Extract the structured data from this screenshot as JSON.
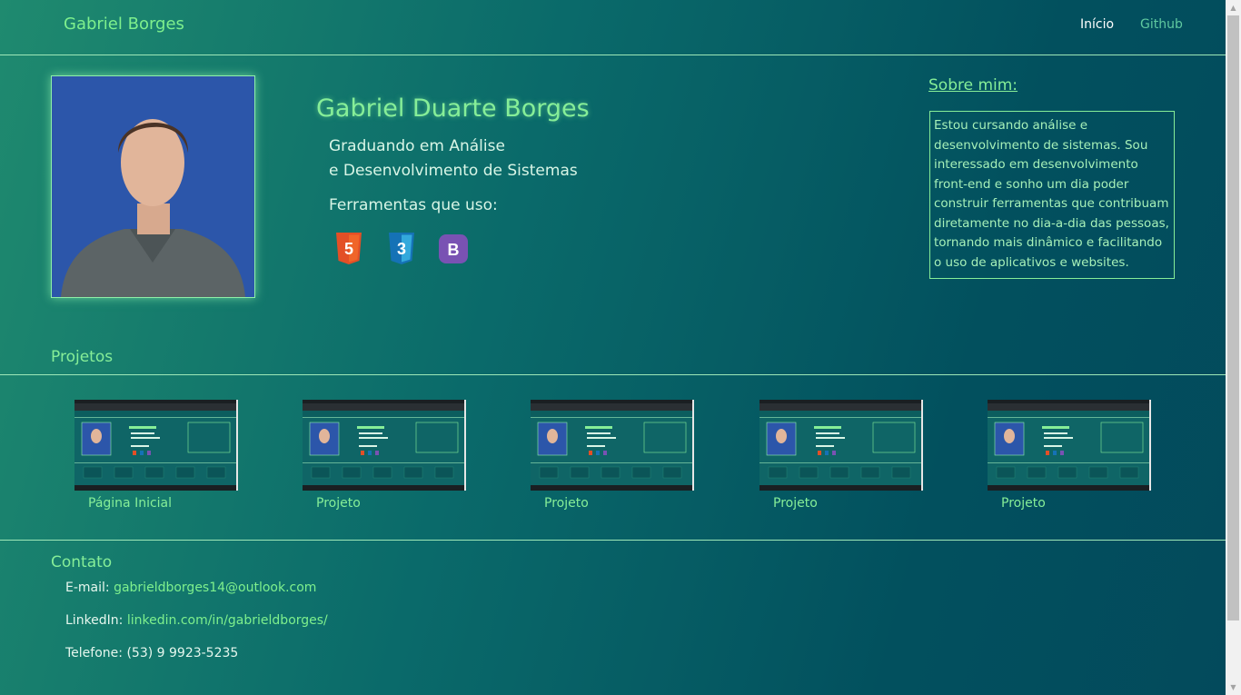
{
  "nav": {
    "brand": "Gabriel Borges",
    "home": "Início",
    "github": "Github"
  },
  "hero": {
    "name": "Gabriel Duarte Borges",
    "role_line1": "Graduando em Análise",
    "role_line2": "e Desenvolvimento de Sistemas",
    "tools_title": "Ferramentas que uso:",
    "tools": [
      {
        "icon": "html5-icon",
        "label": "5",
        "color": "#e34f26"
      },
      {
        "icon": "css3-icon",
        "label": "3",
        "color": "#1572b6"
      },
      {
        "icon": "bootstrap-icon",
        "label": "B",
        "color": "#7952b3"
      }
    ]
  },
  "about": {
    "title": "Sobre mim:",
    "text": "Estou cursando análise e desenvolvimento de sistemas. Sou interessado em desenvolvimento front-end e sonho um dia poder construir ferramentas que contribuam diretamente no dia-a-dia das pessoas, tornando mais dinâmico e facilitando o uso de aplicativos e websites."
  },
  "projects": {
    "title": "Projetos",
    "items": [
      {
        "label": "Página Inicial"
      },
      {
        "label": "Projeto"
      },
      {
        "label": "Projeto"
      },
      {
        "label": "Projeto"
      },
      {
        "label": "Projeto"
      }
    ]
  },
  "contact": {
    "title": "Contato",
    "email_label": "E-mail:",
    "email_value": "gabrieldborges14@outlook.com",
    "linkedin_label": "LinkedIn:",
    "linkedin_value": "linkedin.com/in/gabrieldborges/",
    "phone_label": "Telefone:",
    "phone_value": "(53) 9 9923-5235"
  },
  "colors": {
    "accent": "#86ee98",
    "background_start": "#1f8a6f",
    "background_end": "#034a5c"
  }
}
